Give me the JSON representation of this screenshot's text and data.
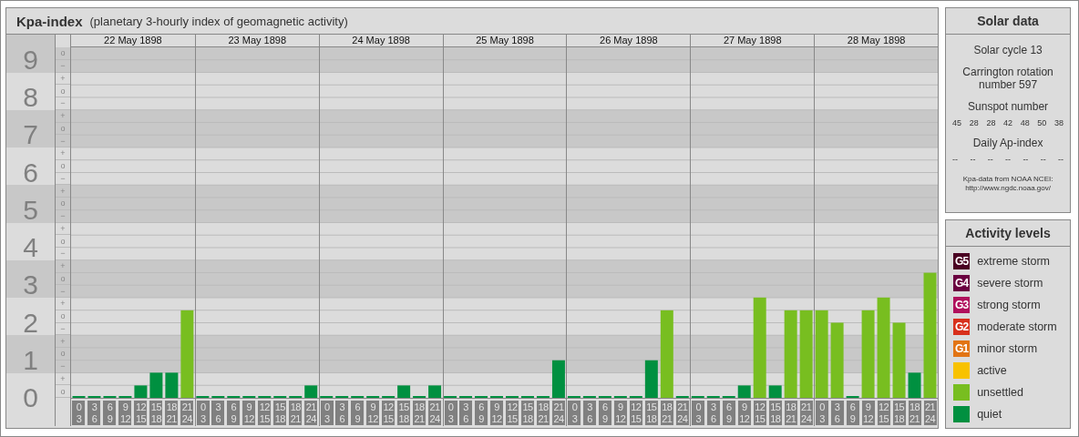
{
  "kp_panel": {
    "title": "Kpa-index",
    "subtitle": "(planetary 3-hourly index of geomagnetic activity)",
    "days": [
      "22 May 1898",
      "23 May 1898",
      "24 May 1898",
      "25 May 1898",
      "26 May 1898",
      "27 May 1898",
      "28 May 1898"
    ],
    "scale_marks": [
      "o",
      "−",
      "+",
      "o",
      "−",
      "+",
      "o",
      "−",
      "+",
      "o",
      "−",
      "+",
      "o",
      "−",
      "+",
      "o",
      "−",
      "+",
      "o",
      "−",
      "+",
      "o",
      "−",
      "+",
      "o",
      "−",
      "+",
      "o"
    ],
    "chart_data": {
      "type": "bar",
      "grid": true,
      "ylim": [
        0,
        9.33
      ],
      "yticks": [
        0,
        1,
        2,
        3,
        4,
        5,
        6,
        7,
        8,
        9
      ],
      "categories": [
        "0 3",
        "3 6",
        "6 9",
        "9 12",
        "12 15",
        "15 18",
        "18 21",
        "21 24",
        "0 3",
        "3 6",
        "6 9",
        "9 12",
        "12 15",
        "15 18",
        "18 21",
        "21 24",
        "0 3",
        "3 6",
        "6 9",
        "9 12",
        "12 15",
        "15 18",
        "18 21",
        "21 24",
        "0 3",
        "3 6",
        "6 9",
        "9 12",
        "12 15",
        "15 18",
        "18 21",
        "21 24",
        "0 3",
        "3 6",
        "6 9",
        "9 12",
        "12 15",
        "15 18",
        "18 21",
        "21 24",
        "0 3",
        "3 6",
        "6 9",
        "9 12",
        "12 15",
        "15 18",
        "18 21",
        "21 24",
        "0 3",
        "3 6",
        "6 9",
        "9 12",
        "12 15",
        "15 18",
        "18 21",
        "21 24"
      ],
      "series": [
        {
          "color": "#009040",
          "values": [
            0,
            0,
            0,
            0,
            0.33,
            0.67,
            0.67,
            null,
            0,
            0,
            0,
            0,
            0,
            0,
            0,
            0.33,
            0,
            0,
            0,
            0,
            0,
            0.33,
            0,
            0.33,
            0,
            0,
            0,
            0,
            0,
            0,
            0,
            1,
            0,
            0,
            0,
            0,
            0,
            1,
            null,
            0,
            0,
            0,
            0,
            0.33,
            null,
            0.33,
            null,
            null,
            null,
            null,
            0,
            null,
            null,
            null,
            0.67,
            null
          ]
        },
        {
          "color": "#78be20",
          "values": [
            null,
            null,
            null,
            null,
            null,
            null,
            null,
            2.33,
            null,
            null,
            null,
            null,
            null,
            null,
            null,
            null,
            null,
            null,
            null,
            null,
            null,
            null,
            null,
            null,
            null,
            null,
            null,
            null,
            null,
            null,
            null,
            null,
            null,
            null,
            null,
            null,
            null,
            null,
            2.33,
            null,
            null,
            null,
            null,
            null,
            2.67,
            null,
            2.33,
            2.33,
            2.33,
            2,
            null,
            2.33,
            2.67,
            2,
            null,
            3.33
          ]
        }
      ]
    }
  },
  "solar_data": {
    "title": "Solar data",
    "solar_cycle": "Solar cycle 13",
    "carrington": "Carrington rotation number 597",
    "sunspot_title": "Sunspot number",
    "sunspot_numbers": [
      "45",
      "28",
      "28",
      "42",
      "48",
      "50",
      "38"
    ],
    "ap_title": "Daily Ap-index",
    "ap_values": [
      "--",
      "--",
      "--",
      "--",
      "--",
      "--",
      "--"
    ],
    "source": "Kpa-data from NOAA NCEI:",
    "source_url": "http://www.ngdc.noaa.gov/"
  },
  "activity_levels": {
    "title": "Activity levels",
    "items": [
      {
        "badge": "G5",
        "label": "extreme storm",
        "color": "#4a0022"
      },
      {
        "badge": "G4",
        "label": "severe storm",
        "color": "#6a0040"
      },
      {
        "badge": "G3",
        "label": "strong storm",
        "color": "#b0105c"
      },
      {
        "badge": "G2",
        "label": "moderate storm",
        "color": "#d8301c"
      },
      {
        "badge": "G1",
        "label": "minor storm",
        "color": "#e27414"
      },
      {
        "label": "active",
        "color": "#f8c200"
      },
      {
        "label": "unsettled",
        "color": "#78be20"
      },
      {
        "label": "quiet",
        "color": "#009040"
      }
    ]
  }
}
